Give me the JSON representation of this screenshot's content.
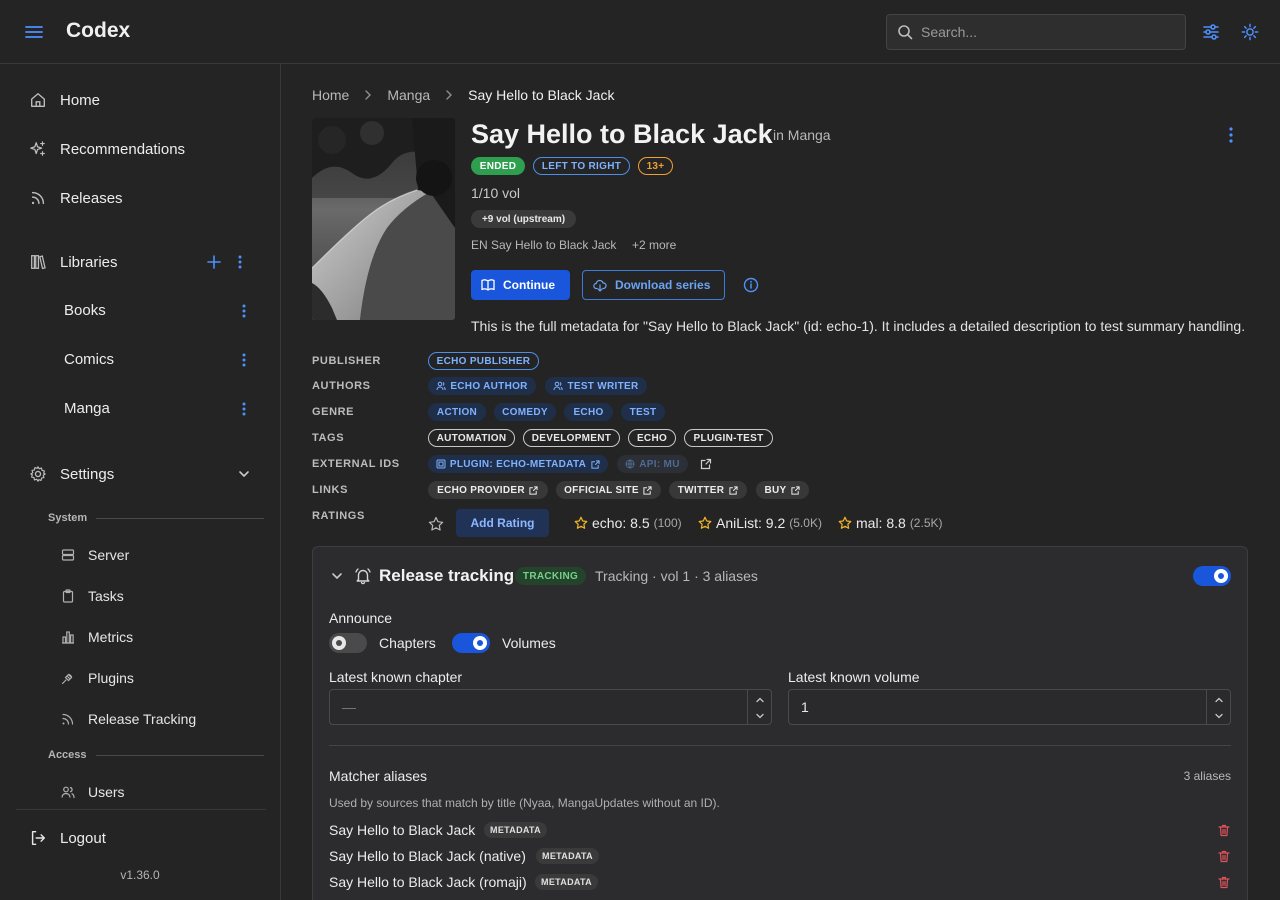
{
  "header": {
    "brand": "Codex",
    "search_placeholder": "Search..."
  },
  "sidebar": {
    "nav": [
      {
        "label": "Home",
        "icon": "home-icon"
      },
      {
        "label": "Recommendations",
        "icon": "sparkle-icon"
      },
      {
        "label": "Releases",
        "icon": "rss-icon"
      }
    ],
    "libraries": {
      "label": "Libraries",
      "items": [
        "Books",
        "Comics",
        "Manga"
      ]
    },
    "settings": {
      "label": "Settings",
      "system_label": "System",
      "system_items": [
        "Server",
        "Tasks",
        "Metrics",
        "Plugins",
        "Release Tracking"
      ],
      "access_label": "Access",
      "access_items": [
        "Users"
      ]
    },
    "logout": "Logout",
    "version": "v1.36.0"
  },
  "breadcrumb": [
    "Home",
    "Manga",
    "Say Hello to Black Jack"
  ],
  "series": {
    "title": "Say Hello to Black Jack",
    "in_library": "in Manga",
    "badges": {
      "status": "ENDED",
      "direction": "LEFT TO RIGHT",
      "age": "13+"
    },
    "volumes": "1/10 vol",
    "upstream": "+9 vol (upstream)",
    "alt_title": "EN Say Hello to Black Jack",
    "alt_more": "+2 more",
    "continue_label": "Continue",
    "download_label": "Download series",
    "summary": "This is the full metadata for \"Say Hello to Black Jack\" (id: echo-1). It includes a detailed description to test summary handling."
  },
  "metadata": {
    "publisher_label": "PUBLISHER",
    "publisher": "ECHO PUBLISHER",
    "authors_label": "AUTHORS",
    "authors": [
      "ECHO AUTHOR",
      "TEST WRITER"
    ],
    "genre_label": "GENRE",
    "genres": [
      "ACTION",
      "COMEDY",
      "ECHO",
      "TEST"
    ],
    "tags_label": "TAGS",
    "tags": [
      "AUTOMATION",
      "DEVELOPMENT",
      "ECHO",
      "PLUGIN-TEST"
    ],
    "external_label": "EXTERNAL IDS",
    "external_ids": [
      "PLUGIN: ECHO-METADATA",
      "API: MU"
    ],
    "links_label": "LINKS",
    "links": [
      "ECHO PROVIDER",
      "OFFICIAL SITE",
      "TWITTER",
      "BUY"
    ],
    "ratings_label": "RATINGS",
    "add_rating": "Add Rating",
    "ratings": [
      {
        "text": "echo: 8.5",
        "count": "(100)"
      },
      {
        "text": "AniList: 9.2",
        "count": "(5.0K)"
      },
      {
        "text": "mal: 8.8",
        "count": "(2.5K)"
      }
    ]
  },
  "tracking": {
    "title": "Release tracking",
    "badge": "TRACKING",
    "subtitle": "Tracking · vol 1 · 3 aliases",
    "enabled": true,
    "announce_label": "Announce",
    "chapters_label": "Chapters",
    "chapters_on": false,
    "volumes_label": "Volumes",
    "volumes_on": true,
    "latest_chapter_label": "Latest known chapter",
    "latest_chapter_placeholder": "—",
    "latest_volume_label": "Latest known volume",
    "latest_volume_value": "1",
    "aliases_heading": "Matcher aliases",
    "aliases_count": "3 aliases",
    "aliases_note": "Used by sources that match by title (Nyaa, MangaUpdates without an ID).",
    "aliases": [
      {
        "text": "Say Hello to Black Jack",
        "source": "METADATA"
      },
      {
        "text": "Say Hello to Black Jack (native)",
        "source": "METADATA"
      },
      {
        "text": "Say Hello to Black Jack (romaji)",
        "source": "METADATA"
      }
    ]
  },
  "colors": {
    "accent": "#4d90fe",
    "primary_button": "#1a56db",
    "ended_badge": "#2e9e4f",
    "age_badge": "#f0a030",
    "delete": "#e0535a"
  }
}
